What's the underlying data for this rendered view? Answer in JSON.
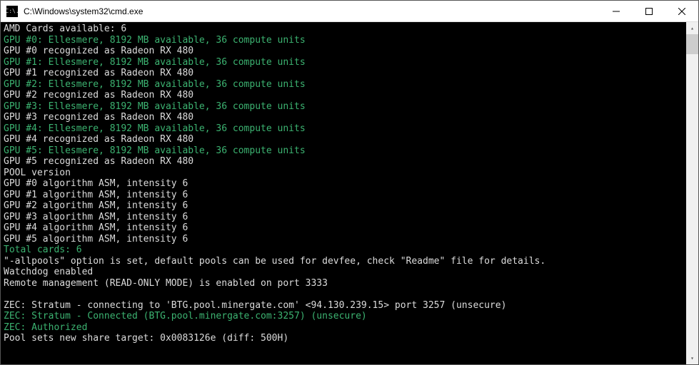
{
  "titlebar": {
    "icon_text": "C:\\.",
    "title": "C:\\Windows\\system32\\cmd.exe"
  },
  "lines": [
    {
      "cls": "white",
      "text": "AMD Cards available: 6"
    },
    {
      "cls": "green",
      "text": "GPU #0: Ellesmere, 8192 MB available, 36 compute units"
    },
    {
      "cls": "white",
      "text": "GPU #0 recognized as Radeon RX 480"
    },
    {
      "cls": "green",
      "text": "GPU #1: Ellesmere, 8192 MB available, 36 compute units"
    },
    {
      "cls": "white",
      "text": "GPU #1 recognized as Radeon RX 480"
    },
    {
      "cls": "green",
      "text": "GPU #2: Ellesmere, 8192 MB available, 36 compute units"
    },
    {
      "cls": "white",
      "text": "GPU #2 recognized as Radeon RX 480"
    },
    {
      "cls": "green",
      "text": "GPU #3: Ellesmere, 8192 MB available, 36 compute units"
    },
    {
      "cls": "white",
      "text": "GPU #3 recognized as Radeon RX 480"
    },
    {
      "cls": "green",
      "text": "GPU #4: Ellesmere, 8192 MB available, 36 compute units"
    },
    {
      "cls": "white",
      "text": "GPU #4 recognized as Radeon RX 480"
    },
    {
      "cls": "green",
      "text": "GPU #5: Ellesmere, 8192 MB available, 36 compute units"
    },
    {
      "cls": "white",
      "text": "GPU #5 recognized as Radeon RX 480"
    },
    {
      "cls": "white",
      "text": "POOL version"
    },
    {
      "cls": "white",
      "text": "GPU #0 algorithm ASM, intensity 6"
    },
    {
      "cls": "white",
      "text": "GPU #1 algorithm ASM, intensity 6"
    },
    {
      "cls": "white",
      "text": "GPU #2 algorithm ASM, intensity 6"
    },
    {
      "cls": "white",
      "text": "GPU #3 algorithm ASM, intensity 6"
    },
    {
      "cls": "white",
      "text": "GPU #4 algorithm ASM, intensity 6"
    },
    {
      "cls": "white",
      "text": "GPU #5 algorithm ASM, intensity 6"
    },
    {
      "cls": "green",
      "text": "Total cards: 6"
    },
    {
      "cls": "white",
      "text": "\"-allpools\" option is set, default pools can be used for devfee, check \"Readme\" file for details."
    },
    {
      "cls": "white",
      "text": "Watchdog enabled"
    },
    {
      "cls": "white",
      "text": "Remote management (READ-ONLY MODE) is enabled on port 3333"
    },
    {
      "cls": "white",
      "text": ""
    },
    {
      "cls": "white",
      "text": "ZEC: Stratum - connecting to 'BTG.pool.minergate.com' <94.130.239.15> port 3257 (unsecure)"
    },
    {
      "cls": "green",
      "text": "ZEC: Stratum - Connected (BTG.pool.minergate.com:3257) (unsecure)"
    },
    {
      "cls": "green",
      "text": "ZEC: Authorized"
    },
    {
      "cls": "white",
      "text": "Pool sets new share target: 0x0083126e (diff: 500H)"
    }
  ]
}
